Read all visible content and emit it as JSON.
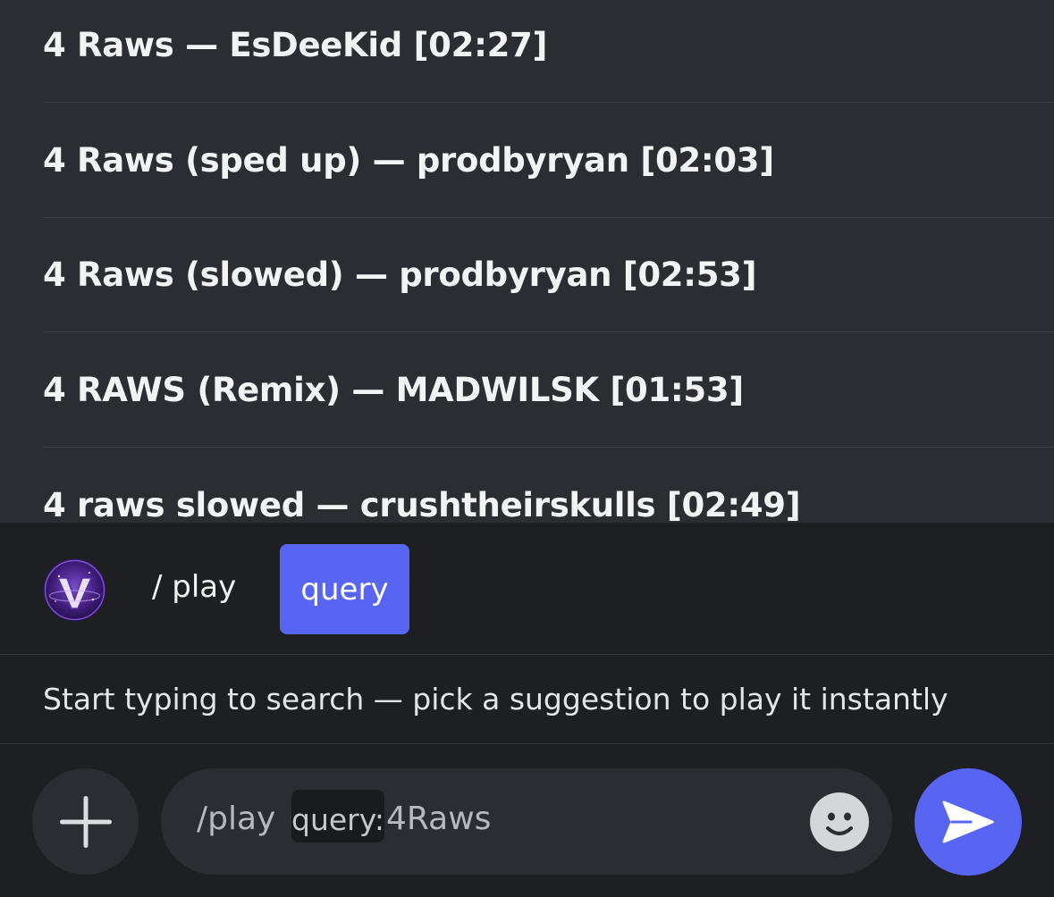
{
  "suggestions": [
    {
      "label": "4 Raws — EsDeeKid [02:27]"
    },
    {
      "label": "4 Raws (sped up) — prodbyryan [02:03]"
    },
    {
      "label": "4 Raws (slowed) — prodbyryan [02:53]"
    },
    {
      "label": "4 RAWS (Remix) — MADWILSK [01:53]"
    },
    {
      "label": "4 raws slowed — crushtheirskulls [02:49]"
    }
  ],
  "command": {
    "name": "/ play",
    "option_chip": "query",
    "avatar_icon": "bot-avatar-icon"
  },
  "hint": {
    "text": "Start typing to search — pick a suggestion to play it instantly"
  },
  "input": {
    "command_prefix": "/play",
    "option_label": "query:",
    "option_value": "4Raws"
  },
  "icons": {
    "plus": "plus-icon",
    "emoji": "emoji-icon",
    "send": "send-icon"
  },
  "colors": {
    "accent": "#5865f2",
    "suggestion_bg": "#2b2d33",
    "background": "#1e1f23"
  }
}
